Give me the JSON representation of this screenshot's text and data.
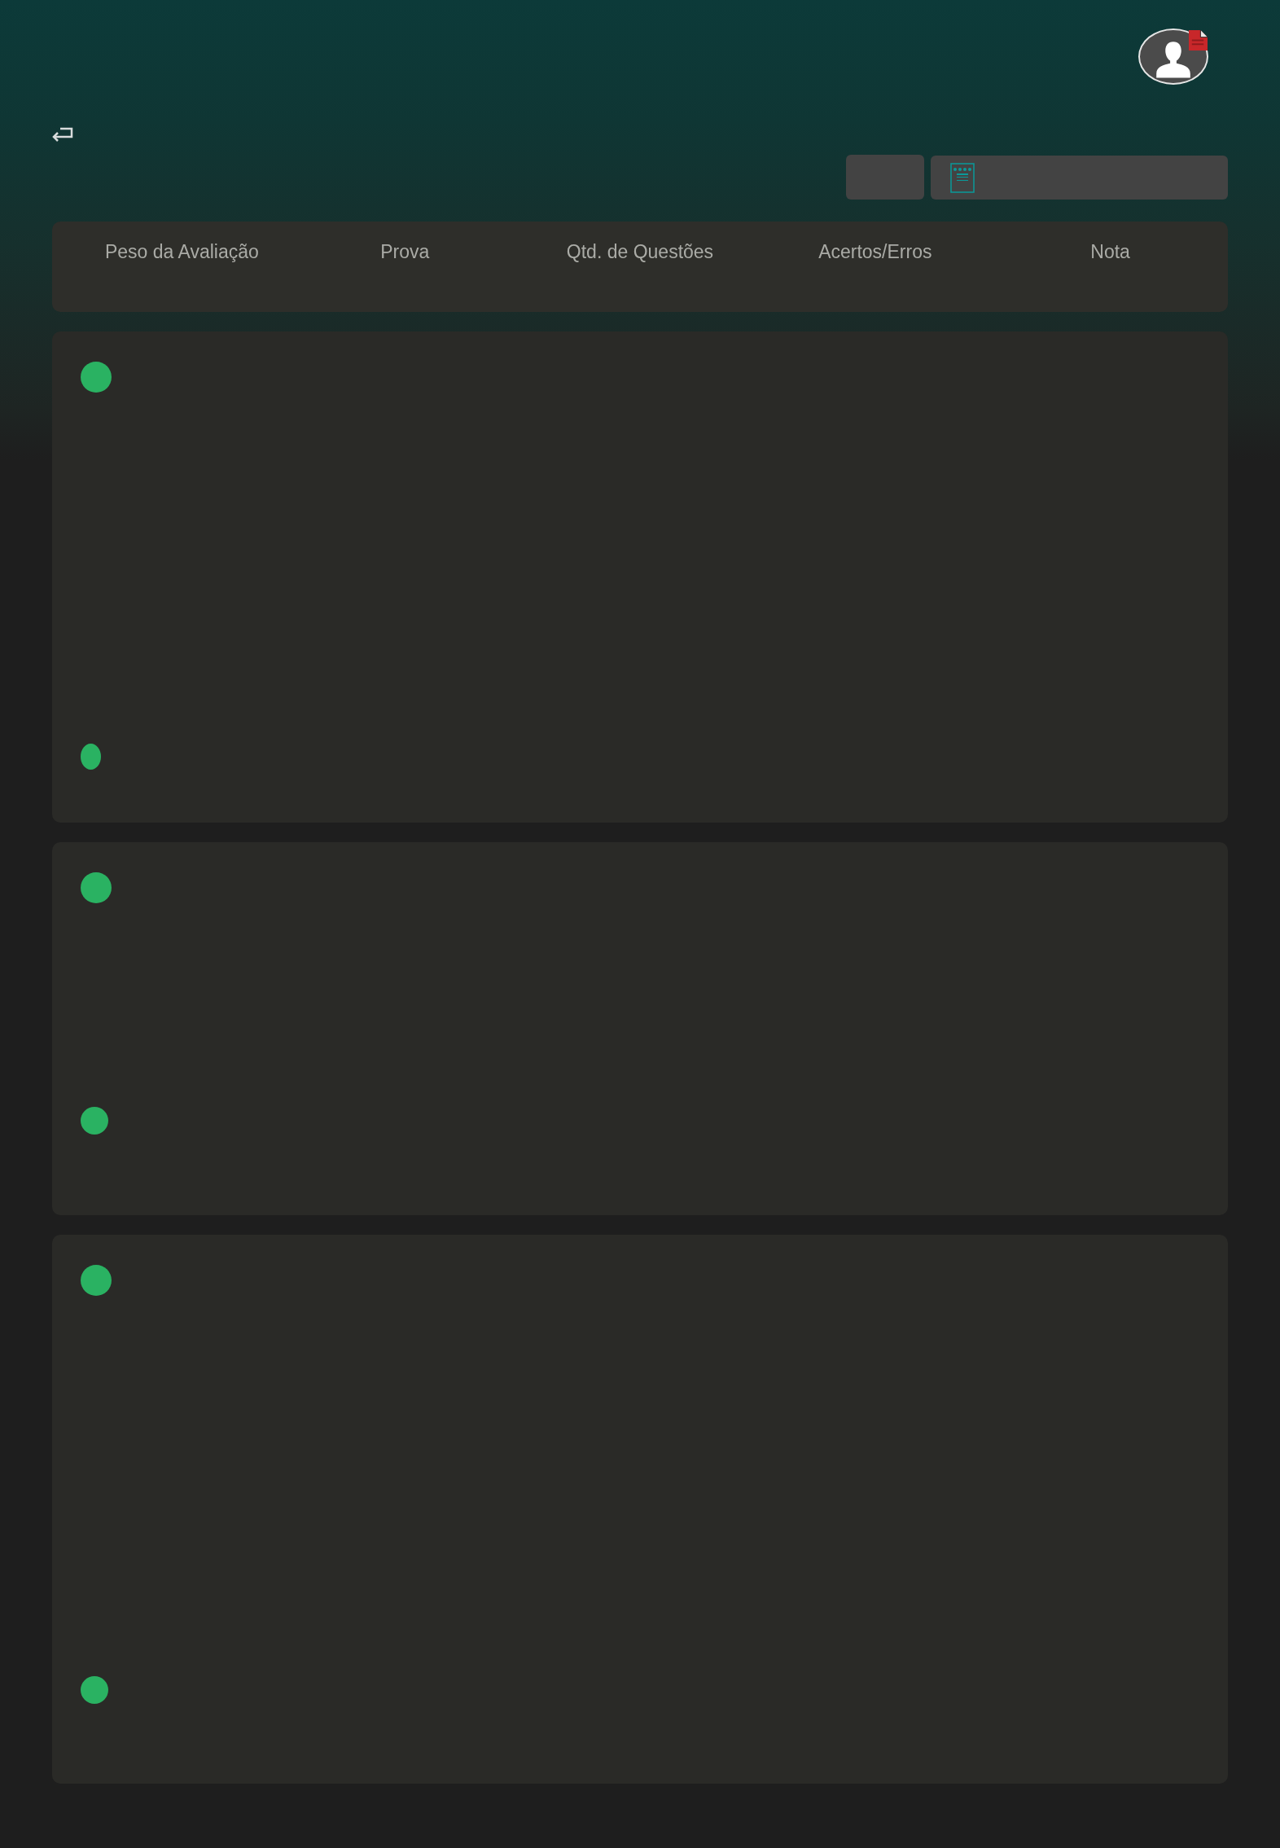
{
  "table_header": {
    "columns": [
      "Peso da Avaliação",
      "Prova",
      "Qtd. de Questões",
      "Acertos/Erros",
      "Nota"
    ]
  },
  "cards": [
    {
      "kind": "large"
    },
    {
      "kind": "medium"
    },
    {
      "kind": "xlarge"
    }
  ]
}
